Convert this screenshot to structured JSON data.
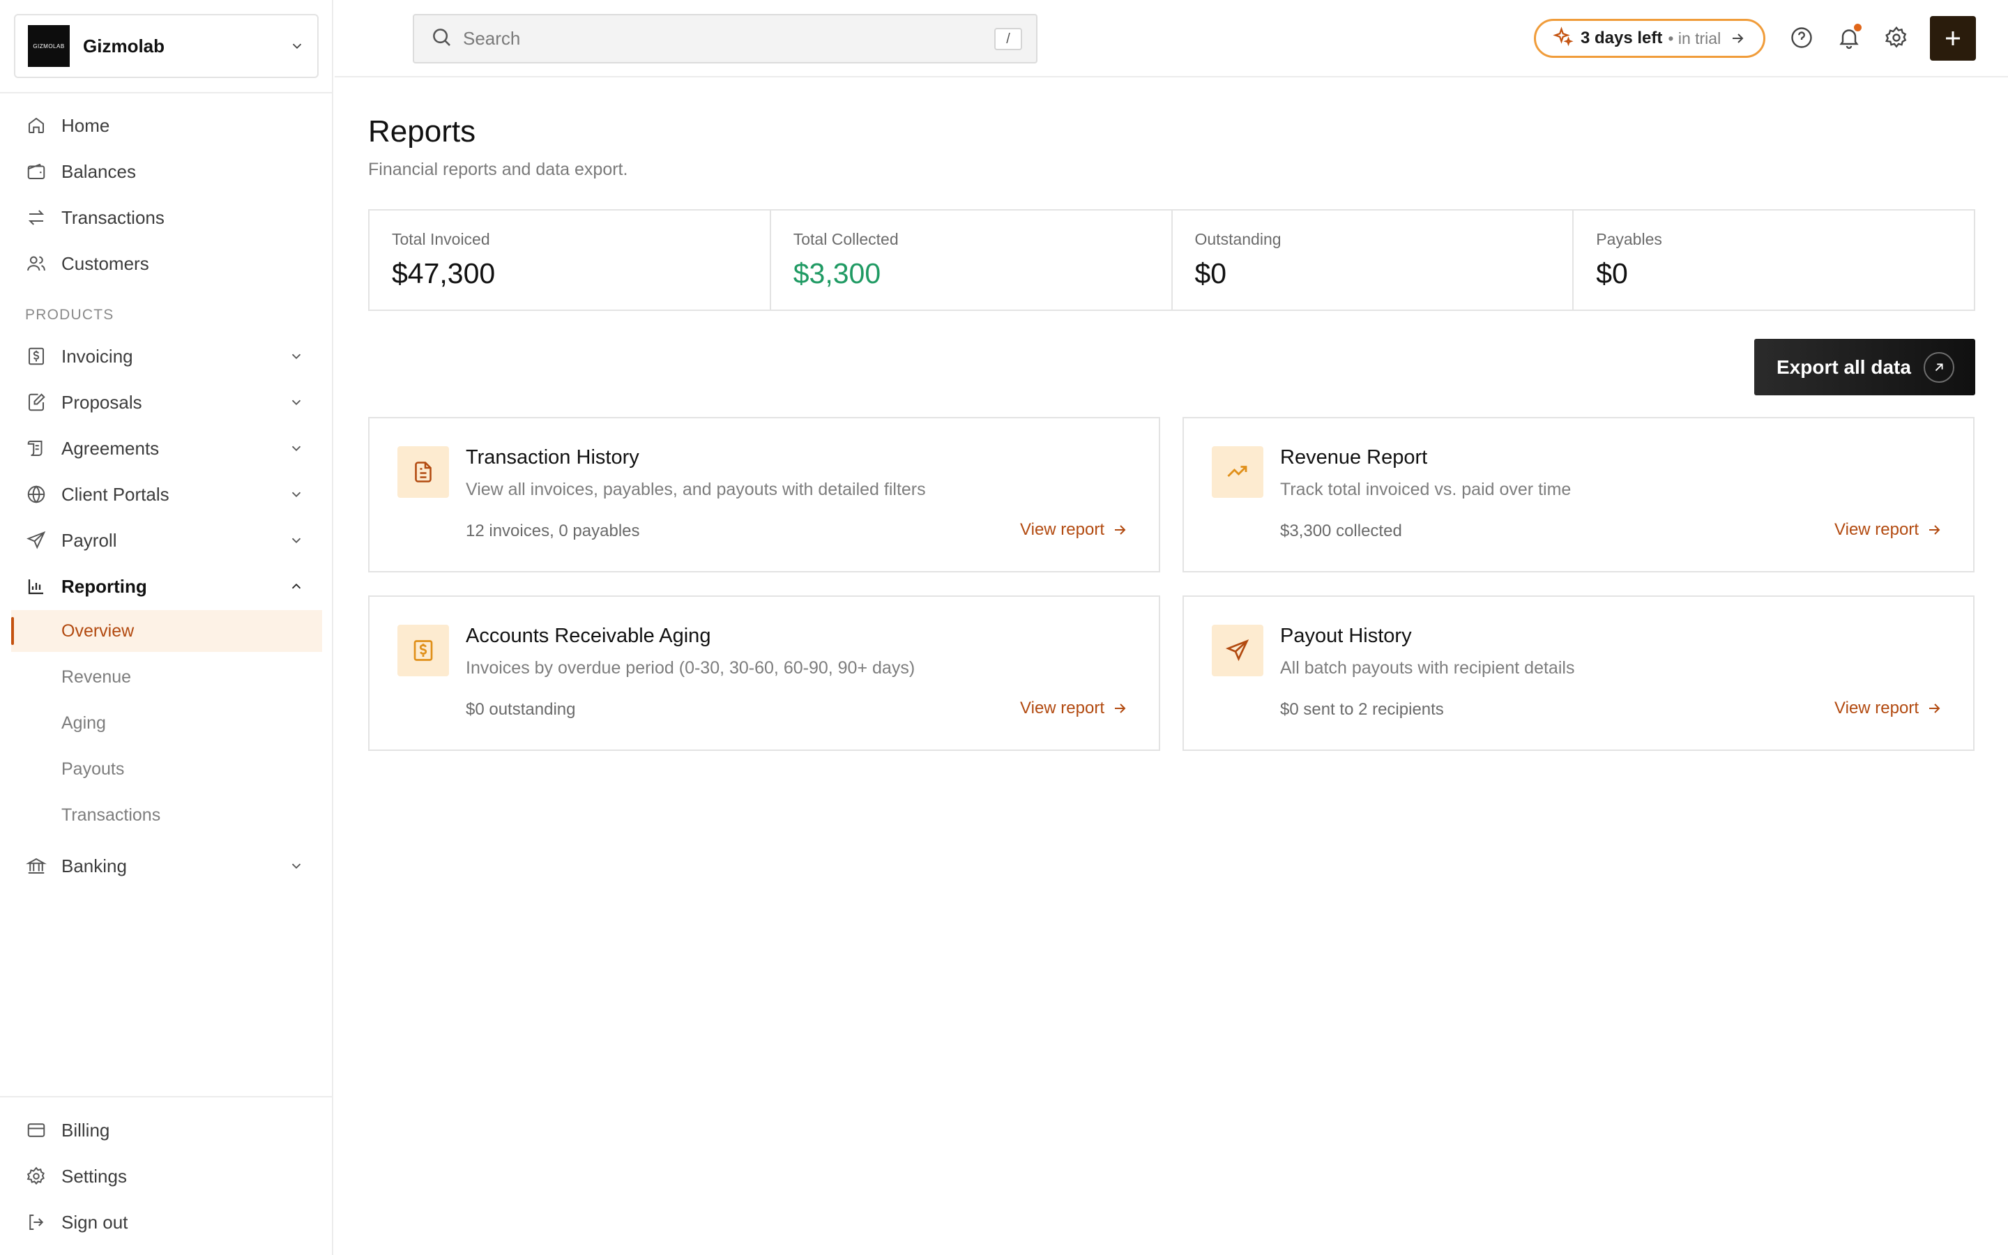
{
  "org": {
    "name": "Gizmolab",
    "logo_text": "GIZMOLAB"
  },
  "sidebar": {
    "main_items": [
      {
        "label": "Home",
        "icon": "home-icon"
      },
      {
        "label": "Balances",
        "icon": "wallet-icon"
      },
      {
        "label": "Transactions",
        "icon": "arrows-left-right-icon"
      },
      {
        "label": "Customers",
        "icon": "users-icon"
      }
    ],
    "section_label": "PRODUCTS",
    "product_items": [
      {
        "label": "Invoicing",
        "icon": "invoice-dollar-icon"
      },
      {
        "label": "Proposals",
        "icon": "document-edit-icon"
      },
      {
        "label": "Agreements",
        "icon": "scroll-icon"
      },
      {
        "label": "Client Portals",
        "icon": "globe-icon"
      },
      {
        "label": "Payroll",
        "icon": "send-icon"
      },
      {
        "label": "Reporting",
        "icon": "bar-chart-icon"
      }
    ],
    "reporting_sub": [
      {
        "label": "Overview",
        "active": true
      },
      {
        "label": "Revenue"
      },
      {
        "label": "Aging"
      },
      {
        "label": "Payouts"
      },
      {
        "label": "Transactions"
      }
    ],
    "banking": {
      "label": "Banking",
      "icon": "bank-icon"
    },
    "bottom_items": [
      {
        "label": "Billing",
        "icon": "credit-card-icon"
      },
      {
        "label": "Settings",
        "icon": "gear-icon"
      },
      {
        "label": "Sign out",
        "icon": "logout-icon"
      }
    ]
  },
  "topbar": {
    "search_placeholder": "Search",
    "search_shortcut": "/",
    "trial_days": "3 days left",
    "trial_sub": "• in trial"
  },
  "page": {
    "title": "Reports",
    "subtitle": "Financial reports and data export."
  },
  "stats": [
    {
      "label": "Total Invoiced",
      "value": "$47,300"
    },
    {
      "label": "Total Collected",
      "value": "$3,300"
    },
    {
      "label": "Outstanding",
      "value": "$0"
    },
    {
      "label": "Payables",
      "value": "$0"
    }
  ],
  "export_label": "Export all data",
  "cards": [
    {
      "title": "Transaction History",
      "desc": "View all invoices, payables, and payouts with detailed filters",
      "meta": "12 invoices, 0 payables",
      "link": "View report",
      "icon": "document-icon"
    },
    {
      "title": "Revenue Report",
      "desc": "Track total invoiced vs. paid over time",
      "meta": "$3,300 collected",
      "link": "View report",
      "icon": "trending-up-icon"
    },
    {
      "title": "Accounts Receivable Aging",
      "desc": "Invoices by overdue period (0-30, 30-60, 60-90, 90+ days)",
      "meta": "$0 outstanding",
      "link": "View report",
      "icon": "dollar-document-icon"
    },
    {
      "title": "Payout History",
      "desc": "All batch payouts with recipient details",
      "meta": "$0 sent to 2 recipients",
      "link": "View report",
      "icon": "send-icon"
    }
  ],
  "colors": {
    "accent": "#b24a10",
    "accent_light": "#fdf2e6",
    "collected_green": "#1f9a63",
    "trial_border": "#f09c3a"
  }
}
